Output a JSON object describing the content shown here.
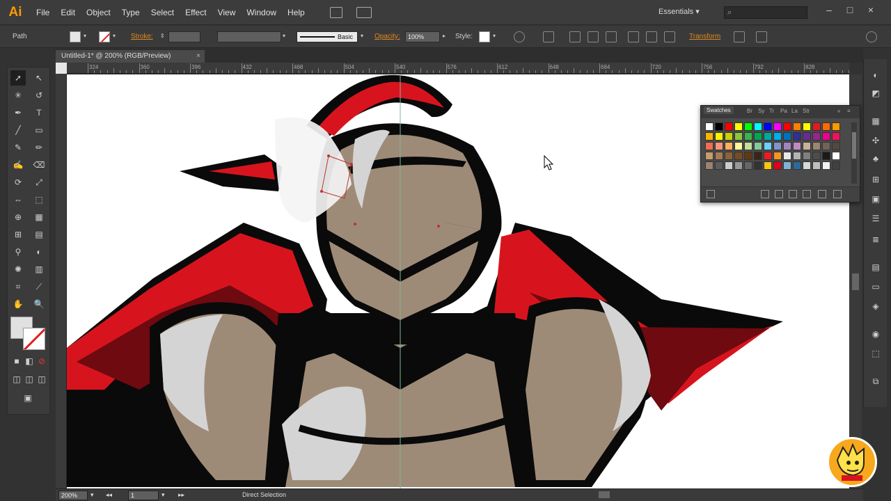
{
  "app": {
    "logo": "Ai",
    "workspace": "Essentials"
  },
  "menu": [
    "File",
    "Edit",
    "Object",
    "Type",
    "Select",
    "Effect",
    "View",
    "Window",
    "Help"
  ],
  "control": {
    "selection_type": "Path",
    "stroke_label": "Stroke:",
    "brush_label": "Basic",
    "opacity_label": "Opacity:",
    "opacity_value": "100%",
    "style_label": "Style:",
    "transform_label": "Transform"
  },
  "document": {
    "tab_title": "Untitled-1* @ 200% (RGB/Preview)",
    "close": "×"
  },
  "ruler": {
    "ticks": [
      "324",
      "360",
      "396",
      "432",
      "468",
      "504",
      "540",
      "576",
      "612",
      "648",
      "684",
      "720",
      "756",
      "792",
      "828",
      "864"
    ]
  },
  "swatches": {
    "tabs": [
      "Swatches",
      "Br",
      "Sy",
      "Tr",
      "Pa",
      "La",
      "Str"
    ],
    "colors": [
      "#ffffff",
      "#000000",
      "#ff0000",
      "#ffff00",
      "#00ff00",
      "#00ffff",
      "#0000ff",
      "#ff00ff",
      "#ff0000",
      "#ff7f00",
      "#ffff00",
      "#e01b24",
      "#ff6a00",
      "#ff9900",
      "#f7b500",
      "#fff200",
      "#c8d400",
      "#8cc63f",
      "#39b54a",
      "#00a651",
      "#00a99d",
      "#00aeef",
      "#0072bc",
      "#2e3192",
      "#662d91",
      "#92278f",
      "#ec008c",
      "#ed145b",
      "#f26c4f",
      "#f69679",
      "#fbaf5d",
      "#fff799",
      "#c4df9b",
      "#82ca9c",
      "#6dcff6",
      "#8393ca",
      "#a186be",
      "#bd8cbf",
      "#c7b299",
      "#998675",
      "#736357",
      "#534741",
      "#c69c6d",
      "#a67c52",
      "#8c6239",
      "#754c24",
      "#603913",
      "#3c2415",
      "#ed1c24",
      "#f7941d",
      "#e8e8e8",
      "#b3b3b3",
      "#808080",
      "#4d4d4d",
      "#1a1a1a",
      "#ffffff",
      "#9a8272",
      "#5c5c5c",
      "#cccccc",
      "#999999",
      "#666666",
      "#333333",
      "#ffc20e",
      "#e2001a",
      "#7fb2d6",
      "#2c6a9a",
      "#d9d9d9",
      "#bfbfbf",
      "#f2f2f2",
      "#404040"
    ]
  },
  "status": {
    "zoom": "200%",
    "page": "1",
    "tool": "Direct Selection"
  },
  "colors": {
    "accent_orange": "#e08a1f",
    "red": "#d7141e",
    "dark_red": "#6e0a10",
    "skin": "#9e8b77",
    "black": "#080808",
    "gray": "#d4d4d4"
  }
}
